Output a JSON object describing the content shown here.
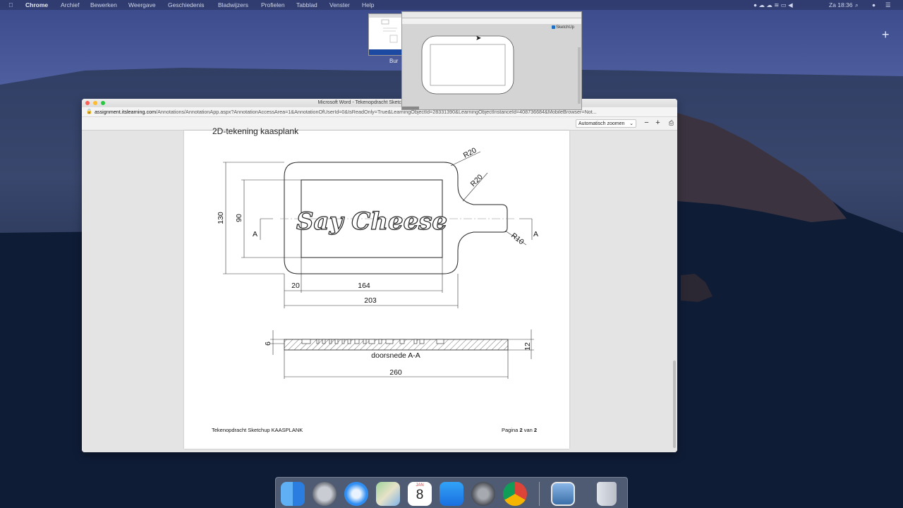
{
  "menubar": {
    "app": "Chrome",
    "items": [
      "Archief",
      "Bewerken",
      "Weergave",
      "Geschiedenis",
      "Bladwijzers",
      "Profielen",
      "Tabblad",
      "Venster",
      "Help"
    ],
    "clock": "Za 18:36"
  },
  "window": {
    "title": "Microsoft Word - Tekenopdracht Sketchup Kaasplank - T",
    "url_host": "assignment.itslearning.com",
    "url_path": "/Annotations/AnnotationApp.aspx?AnnotationAccessArea=1&AnnotationOfUserId=0&IsReadOnly=True&LearningObjectId=28331390&LearningObjectInstanceId=408736684&MobileBrowser=Not..."
  },
  "viewer": {
    "zoom": "Automatisch zoomen"
  },
  "document": {
    "heading": "2D-tekening kaasplank",
    "logo_text": "Say Cheese",
    "dims": {
      "r20_top": "R20",
      "r20_mid": "R20",
      "r10": "R10",
      "h130": "130",
      "h90": "90",
      "w20": "20",
      "w164": "164",
      "w203": "203",
      "t6": "6",
      "t12": "12",
      "w260": "260",
      "sec_a_left": "A",
      "sec_a_right": "A"
    },
    "section_label": "doorsnede A-A",
    "footer_left": "Tekenopdracht Sketchup KAASPLANK",
    "footer_page_word": "Pagina",
    "footer_page": "2",
    "footer_of": "van",
    "footer_total": "2"
  },
  "thumbnails": {
    "small_caption": "Bur",
    "sketchup_label": "SketchUp"
  },
  "colors": {
    "accent_close": "#fe5f57",
    "accent_min": "#febc2e",
    "accent_max": "#28c840"
  },
  "dock_icons": [
    "finder-icon",
    "launchpad-icon",
    "safari-icon",
    "maps-icon",
    "calendar-icon",
    "app-store-icon",
    "system-preferences-icon",
    "chrome-icon",
    "preview-icon",
    "trash-icon"
  ],
  "calendar": {
    "month": "JAN",
    "day": "8"
  }
}
